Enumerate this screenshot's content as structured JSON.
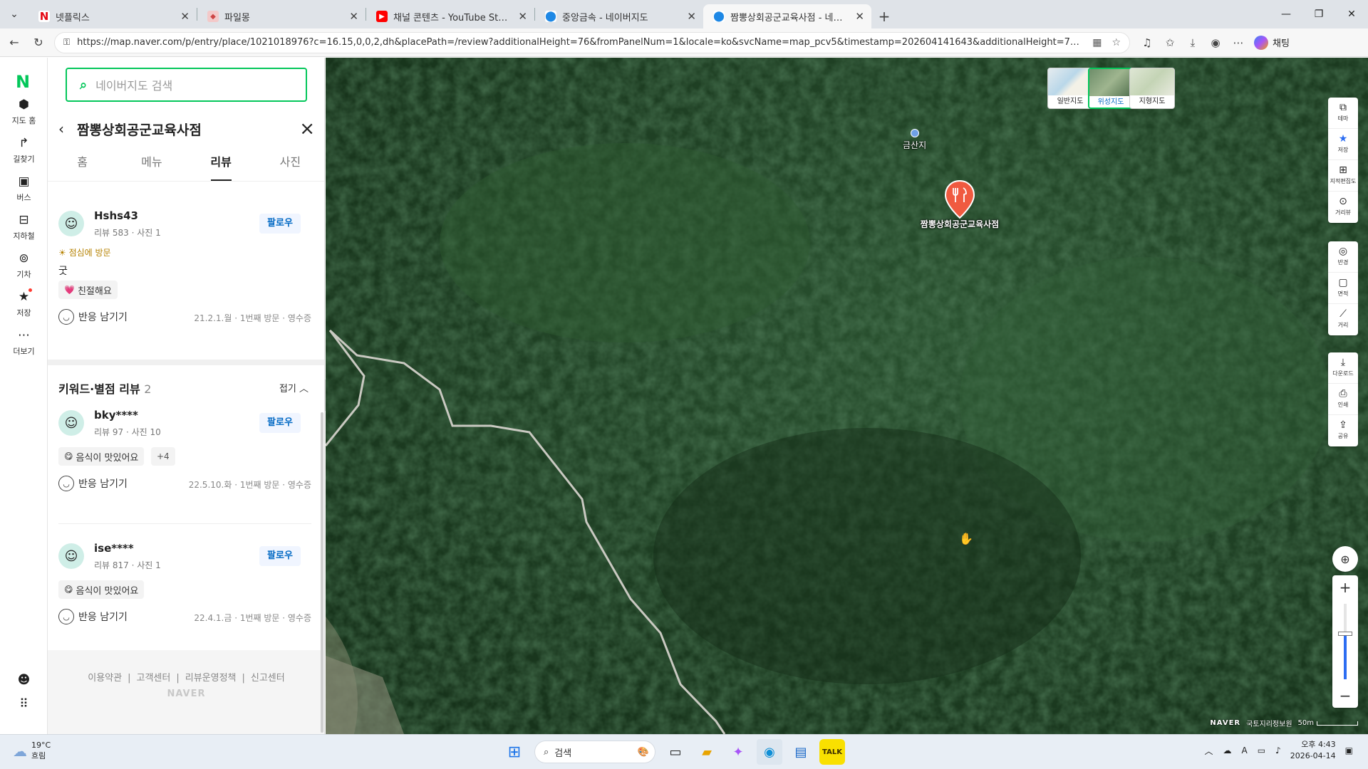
{
  "browser": {
    "tabs": [
      {
        "title": "넷플릭스",
        "favicon": "netflix-icon",
        "color": "#e50914",
        "active": false
      },
      {
        "title": "파일몽",
        "favicon": "filemong-icon",
        "color": "#e88",
        "active": false
      },
      {
        "title": "채널 콘텐츠 - YouTube Studio",
        "favicon": "youtube-icon",
        "color": "#ff0000",
        "active": false
      },
      {
        "title": "중앙금속 - 네이버지도",
        "favicon": "map-pin-icon",
        "color": "#03c75a",
        "active": false
      },
      {
        "title": "짬뽕상회공군교육사점 - 네이버지",
        "favicon": "map-pin-icon",
        "color": "#03c75a",
        "active": true
      }
    ],
    "url": "https://map.naver.com/p/entry/place/1021018976?c=16.15,0,0,2,dh&placePath=/review?additionalHeight=76&fromPanelNum=1&locale=ko&svcName=map_pcv5&timestamp=202604141643&additionalHeight=76&timestamp=202604141...",
    "chat_label": "채팅"
  },
  "rail": {
    "logo": "N",
    "items": [
      {
        "label": "지도 홈",
        "icon": "map-pin-icon"
      },
      {
        "label": "길찾기",
        "icon": "directions-icon"
      },
      {
        "label": "버스",
        "icon": "bus-icon"
      },
      {
        "label": "지하철",
        "icon": "subway-icon"
      },
      {
        "label": "기차",
        "icon": "train-icon"
      },
      {
        "label": "저장",
        "icon": "star-icon"
      },
      {
        "label": "더보기",
        "icon": "more-icon"
      }
    ]
  },
  "panel": {
    "search_placeholder": "네이버지도 검색",
    "place_title": "짬뽕상회공군교육사점",
    "tabs": [
      "홈",
      "메뉴",
      "리뷰",
      "사진"
    ],
    "active_tab": "리뷰",
    "reviews": [
      {
        "user": "Hshs43",
        "stats": "리뷰 583 · 사진 1",
        "follow": "팔로우",
        "visit": "점심에 방문",
        "text": "굿",
        "chip": "친절해요",
        "react": "반응 남기기",
        "meta": "21.2.1.월 · 1번째 방문 · 영수증"
      }
    ],
    "keyword_section": {
      "title": "키워드·별점 리뷰",
      "count": "2",
      "fold": "접기"
    },
    "keyword_reviews": [
      {
        "user": "bky****",
        "stats": "리뷰 97 · 사진 10",
        "follow": "팔로우",
        "chip": "음식이 맛있어요",
        "more": "+4",
        "react": "반응 남기기",
        "meta": "22.5.10.화 · 1번째 방문 · 영수증"
      },
      {
        "user": "ise****",
        "stats": "리뷰 817 · 사진 1",
        "follow": "팔로우",
        "chip": "음식이 맛있어요",
        "react": "반응 남기기",
        "meta": "22.4.1.금 · 1번째 방문 · 영수증"
      }
    ],
    "footer_links": [
      "이용약관",
      "고객센터",
      "리뷰운영정책",
      "신고센터"
    ],
    "footer_brand": "NAVER"
  },
  "map": {
    "types": [
      {
        "label": "일반지도",
        "active": false
      },
      {
        "label": "위성지도",
        "active": true
      },
      {
        "label": "지형지도",
        "active": false
      }
    ],
    "tools": [
      {
        "label": "테마",
        "icon": "layers-icon"
      },
      {
        "label": "저장",
        "icon": "star-icon"
      },
      {
        "label": "지적편집도",
        "icon": "cadastral-icon"
      },
      {
        "label": "거리뷰",
        "icon": "streetview-icon"
      },
      {
        "label": "반경",
        "icon": "radius-icon"
      },
      {
        "label": "면적",
        "icon": "area-icon"
      },
      {
        "label": "거리",
        "icon": "ruler-icon"
      },
      {
        "label": "다운로드",
        "icon": "download-icon"
      },
      {
        "label": "인쇄",
        "icon": "print-icon"
      },
      {
        "label": "공유",
        "icon": "share-icon"
      }
    ],
    "poi_label": "금산지",
    "place_marker_label": "짬뽕상회공군교육사점",
    "footer_brand": "NAVER",
    "footer_source": "국토지리정보원",
    "scale": "50m",
    "zoom_level_fraction": 0.6
  },
  "taskbar": {
    "weather_temp": "19°C",
    "weather_desc": "흐림",
    "search_placeholder": "검색",
    "time": "오후 4:43",
    "date": "2026-04-14"
  }
}
